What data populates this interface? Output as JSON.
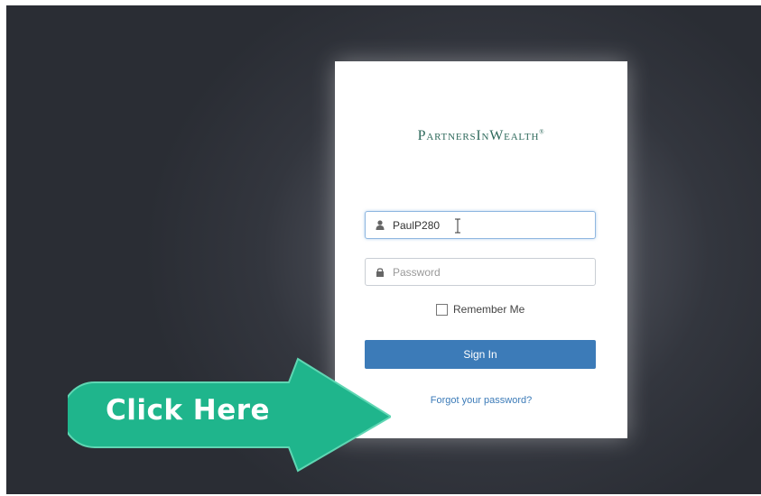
{
  "login": {
    "brand_logo": "PartnersInWealth",
    "username_value": "PaulP280",
    "password_placeholder": "Password",
    "remember_label": "Remember Me",
    "remember_checked": false,
    "signin_label": "Sign In",
    "forgot_link": "Forgot your password?"
  },
  "callout": {
    "label": "Click Here",
    "color": "#1fb58c"
  },
  "colors": {
    "brand": "#2f6a5c",
    "primary_button": "#3c7bb8",
    "link": "#3c7bb8",
    "background": "#33363e"
  },
  "icons": {
    "username": "user-icon",
    "password": "lock-icon",
    "text_cursor": "text-cursor-icon"
  }
}
